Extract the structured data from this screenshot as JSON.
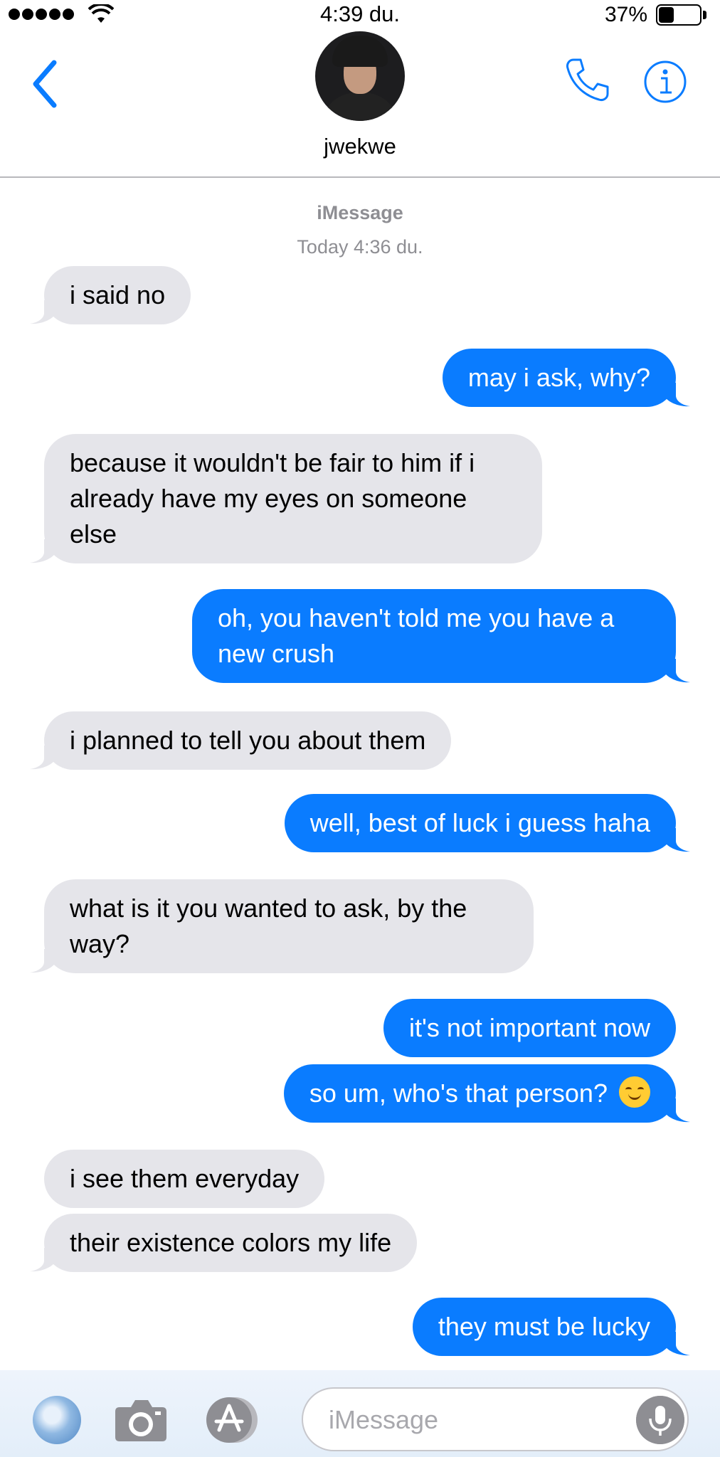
{
  "status_bar": {
    "time": "4:39 du.",
    "battery_percent_label": "37%",
    "battery_level": 0.37,
    "signal_dots": 5
  },
  "header": {
    "contact_name": "jwekwe",
    "back_icon": "chevron-left-icon",
    "call_icon": "phone-icon",
    "info_icon": "info-icon",
    "accent_color": "#0a7cff"
  },
  "conversation": {
    "service_label": "iMessage",
    "timestamp": "Today 4:36 du.",
    "messages": [
      {
        "direction": "in",
        "text": "i said no"
      },
      {
        "direction": "out",
        "text": "may i ask, why?"
      },
      {
        "direction": "in",
        "text": "because it wouldn't be fair to him if i already have my eyes on someone else"
      },
      {
        "direction": "out",
        "text": "oh, you haven't told me you have a new crush"
      },
      {
        "direction": "in",
        "text": "i planned to tell you about them"
      },
      {
        "direction": "out",
        "text": "well, best of luck i guess haha"
      },
      {
        "direction": "in",
        "text": "what is it you wanted to ask, by the way?"
      },
      {
        "direction": "out",
        "text": "it's not important now"
      },
      {
        "direction": "out",
        "text": "so um, who's that person?",
        "emoji": "smiling-face-icon"
      },
      {
        "direction": "in",
        "text": "i see them everyday"
      },
      {
        "direction": "in",
        "text": "their existence colors my life"
      },
      {
        "direction": "out",
        "text": "they must be lucky"
      }
    ],
    "incoming_color": "#e5e5ea",
    "outgoing_color": "#0a7cff"
  },
  "input_bar": {
    "placeholder": "iMessage",
    "value": "",
    "photos_icon": "photos-icon",
    "camera_icon": "camera-icon",
    "apps_icon": "app-store-icon",
    "mic_icon": "microphone-icon"
  }
}
